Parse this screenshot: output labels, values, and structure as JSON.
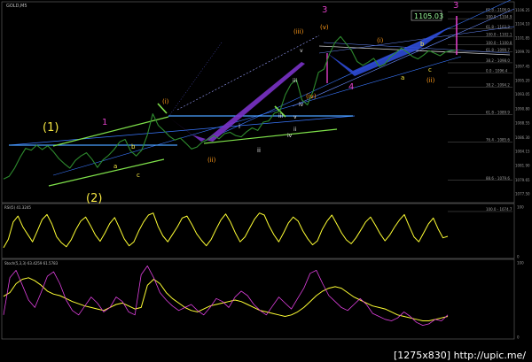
{
  "chart_data": [
    {
      "type": "line",
      "symbol": "GOLD,M5",
      "price_box": "1105.03",
      "yticks": [
        "1106.25",
        "1104.10",
        "1101.85",
        "1099.70",
        "1097.45",
        "1095.20",
        "1093.05",
        "1090.80",
        "1088.55",
        "1086.30",
        "1084.15",
        "1081.90",
        "1079.65",
        "1077.50"
      ],
      "ylim": [
        1076.5,
        1107
      ],
      "fib_levels": [
        {
          "label": "61.8 - 1106.0",
          "value": 1106.0
        },
        {
          "label": "100.0 - 1104.9",
          "value": 1104.9
        },
        {
          "label": "61.8 - 1103.3",
          "value": 1103.3
        },
        {
          "label": "100.0 - 1102.1",
          "value": 1102.1
        },
        {
          "label": "100.0 - 1100.8",
          "value": 1100.8
        },
        {
          "label": "61.8 - 1099.7",
          "value": 1099.7
        },
        {
          "label": "38.2 - 1098.0",
          "value": 1098.0
        },
        {
          "label": "0.0 - 1096.4",
          "value": 1096.4
        },
        {
          "label": "38.2 - 1094.2",
          "value": 1094.2
        },
        {
          "label": "61.8 - 1089.9",
          "value": 1089.9
        },
        {
          "label": "76.4 - 1085.6",
          "value": 1085.6
        },
        {
          "label": "88.6 - 1079.6",
          "value": 1079.6
        },
        {
          "label": "100.0 - 1074.7",
          "value": 1074.7
        }
      ],
      "series": [
        {
          "values": [
            1079.8,
            1080.2,
            1081.5,
            1083.2,
            1084.6,
            1084.3,
            1085.1,
            1084.4,
            1085.0,
            1084.1,
            1083.0,
            1082.2,
            1081.5,
            1082.7,
            1083.4,
            1083.9,
            1082.9,
            1081.6,
            1082.8,
            1083.5,
            1084.4,
            1085.6,
            1086.0,
            1084.2,
            1083.4,
            1084.3,
            1086.6,
            1090.0,
            1088.2,
            1087.4,
            1086.5,
            1085.9,
            1086.2,
            1085.4,
            1084.5,
            1084.8,
            1085.6,
            1086.0,
            1086.6,
            1086.1,
            1086.9,
            1087.1,
            1086.6,
            1086.4,
            1087.2,
            1087.8,
            1087.4,
            1088.7,
            1088.9,
            1090.1,
            1090.4,
            1093.0,
            1094.6,
            1095.4,
            1092.2,
            1091.4,
            1093.5,
            1096.5,
            1097.0,
            1099.4,
            1101.2,
            1102.1,
            1101.0,
            1099.9,
            1098.2,
            1097.6,
            1098.1,
            1098.7,
            1097.4,
            1097.8,
            1098.9,
            1099.6,
            1100.3,
            1099.7,
            1099.0,
            1098.6,
            1099.2,
            1099.9,
            1099.5,
            1099.1,
            1099.7,
            1099.9,
            1100.0
          ]
        }
      ]
    },
    {
      "type": "line",
      "label": "RSI(5) 41.3245",
      "yticks": [
        "100",
        "0"
      ],
      "ylim": [
        0,
        100
      ],
      "series": [
        {
          "values": [
            18,
            35,
            70,
            82,
            60,
            45,
            30,
            52,
            75,
            85,
            66,
            40,
            28,
            20,
            34,
            55,
            72,
            80,
            63,
            44,
            31,
            48,
            67,
            79,
            58,
            36,
            22,
            30,
            52,
            70,
            84,
            88,
            61,
            42,
            30,
            45,
            60,
            78,
            82,
            65,
            46,
            33,
            22,
            35,
            55,
            74,
            86,
            70,
            48,
            30,
            40,
            58,
            76,
            88,
            84,
            62,
            44,
            30,
            48,
            68,
            80,
            72,
            52,
            36,
            24,
            32,
            55,
            72,
            84,
            66,
            48,
            34,
            26,
            38,
            54,
            70,
            80,
            64,
            46,
            32,
            44,
            60,
            74,
            85,
            62,
            40,
            30,
            48,
            66,
            78,
            56,
            38,
            41
          ]
        }
      ]
    },
    {
      "type": "line",
      "label": "Stoch(5,3,3) 63.4259 61.5783",
      "yticks": [
        "100",
        "0"
      ],
      "ylim": [
        0,
        100
      ],
      "series": [
        {
          "values": [
            55,
            60,
            72,
            78,
            80,
            76,
            70,
            62,
            58,
            56,
            52,
            48,
            45,
            42,
            40,
            38,
            36,
            40,
            44,
            46,
            42,
            38,
            40,
            70,
            78,
            72,
            60,
            52,
            46,
            40,
            36,
            34,
            38,
            42,
            44,
            46,
            48,
            50,
            48,
            44,
            40,
            36,
            34,
            32,
            30,
            28,
            30,
            34,
            40,
            48,
            56,
            62,
            66,
            68,
            66,
            60,
            54,
            50,
            46,
            42,
            40,
            38,
            34,
            30,
            28,
            26,
            24,
            22,
            22,
            24,
            26,
            28
          ]
        },
        {
          "values": [
            30,
            80,
            90,
            70,
            50,
            40,
            60,
            82,
            88,
            72,
            50,
            36,
            30,
            42,
            54,
            46,
            34,
            40,
            54,
            48,
            34,
            30,
            84,
            96,
            80,
            60,
            50,
            42,
            36,
            40,
            44,
            36,
            30,
            40,
            52,
            48,
            40,
            54,
            62,
            56,
            44,
            36,
            30,
            42,
            54,
            46,
            38,
            52,
            66,
            86,
            90,
            72,
            56,
            48,
            40,
            36,
            44,
            52,
            44,
            32,
            28,
            24,
            22,
            26,
            34,
            28,
            20,
            16,
            18,
            24,
            22,
            30
          ]
        }
      ]
    }
  ],
  "wave_labels": {
    "w1": "(1)",
    "w2": "(2)",
    "m1": "1",
    "m3": "3",
    "m4": "4",
    "o_i": "(i)",
    "o_ii": "(ii)",
    "o_iii": "(iii)",
    "o_iv": "(iv)",
    "o_v": "(v)",
    "o_i2": "(i)",
    "o_ii2": "(ii)",
    "w_a": "a",
    "w_b": "b",
    "w_c": "c",
    "w_i": "i",
    "w_ii": "ii",
    "w_iii": "iii",
    "w_iv": "iv",
    "w_v": "v",
    "w_a2": "a",
    "w_b2": "b",
    "w_c2": "c",
    "w_iii2": "iii",
    "w_iv2": "iv",
    "w_v2": "v"
  },
  "watermark": "[1275x830] http://upic.me/",
  "colors": {
    "price": "#2e8b2e",
    "rsi": "#ffff33",
    "stoch_main": "#ffff33",
    "stoch_signal": "#e040e0",
    "channel": "#2a44ff",
    "trend_green": "#7fe24a",
    "trend_blue": "#4aa0ff",
    "poly_purple": "#7a32c8",
    "poly_blue": "#2d4bd6",
    "fib": "#7a7a7a"
  }
}
